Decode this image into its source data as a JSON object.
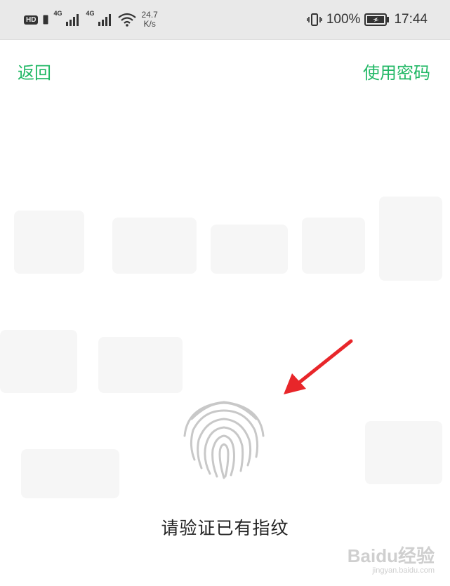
{
  "status_bar": {
    "hd_badge": "HD",
    "network_1": "4G",
    "network_2": "4G",
    "speed_value": "24.7",
    "speed_unit": "K/s",
    "battery": "100%",
    "time": "17:44"
  },
  "nav": {
    "back_label": "返回",
    "password_label": "使用密码"
  },
  "fingerprint": {
    "prompt": "请验证已有指纹",
    "icon": "fingerprint-icon"
  },
  "annotation": {
    "icon": "red-arrow-icon",
    "color": "#e8262a"
  },
  "watermark": {
    "brand": "Baidu经验",
    "domain": "jingyan.baidu.com"
  },
  "colors": {
    "accent": "#22b866",
    "status_bar_bg": "#e9e9e9",
    "prompt_text": "#222222"
  }
}
